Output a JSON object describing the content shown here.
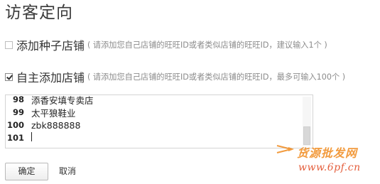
{
  "page": {
    "title": "访客定向"
  },
  "options": {
    "seed_shops": {
      "label": "添加种子店铺",
      "hint": "( 请添加您自己店铺的旺旺ID或者类似店铺的旺旺ID，建议输入1个 )",
      "checked": false
    },
    "custom_shops": {
      "label": "自主添加店铺",
      "hint": "( 请添加您自己店铺的旺旺ID或者类似店铺的旺旺ID，最多可输入100个 )",
      "checked": true
    }
  },
  "editor": {
    "lines": [
      {
        "num": "98",
        "text": "添香安填专卖店"
      },
      {
        "num": "99",
        "text": "太平狼鞋业"
      },
      {
        "num": "100",
        "text": "zbk888888"
      },
      {
        "num": "101",
        "text": ""
      }
    ]
  },
  "buttons": {
    "confirm": "确定",
    "cancel": "取消"
  },
  "watermark": {
    "line1": "货源批发网",
    "line2": "www.6pf.cn",
    "colors": {
      "line1": "#f08a1d",
      "line2": "#e0431b"
    }
  }
}
